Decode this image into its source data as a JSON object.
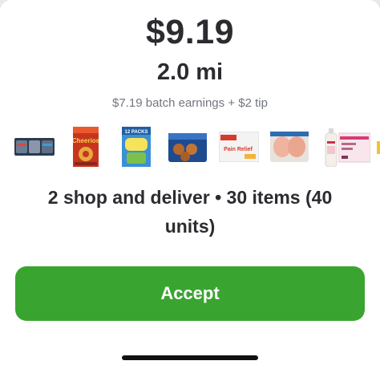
{
  "offer": {
    "amount": "$9.19",
    "distance": "2.0 mi",
    "earnings_breakdown": "$7.19 batch earnings + $2 tip",
    "summary": "2 shop and deliver • 30 items (40 units)",
    "accept_label": "Accept"
  },
  "product_images": [
    {
      "name": "cat-food-cans",
      "brand_text": ""
    },
    {
      "name": "cheerios-cereal",
      "brand_text": "Cheerios"
    },
    {
      "name": "snack-pack",
      "brand_text": "12 PACKS"
    },
    {
      "name": "frozen-muffins",
      "brand_text": ""
    },
    {
      "name": "pain-relief-box",
      "brand_text": "Pain Relief"
    },
    {
      "name": "chicken-breast-pack",
      "brand_text": ""
    },
    {
      "name": "lotion-bottle",
      "brand_text": ""
    },
    {
      "name": "pink-box",
      "brand_text": ""
    }
  ],
  "colors": {
    "accept_green": "#3aa430",
    "text_dark": "#2b2c2f",
    "text_muted": "#72767e"
  }
}
